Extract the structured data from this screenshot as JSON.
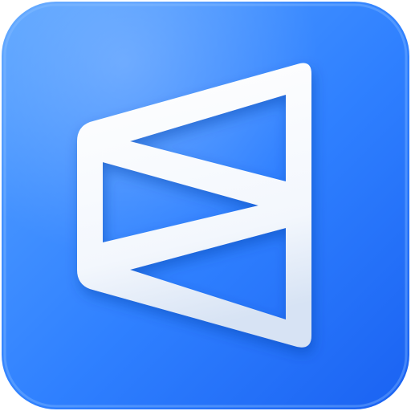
{
  "icon": {
    "name": "app-icon-glyph",
    "description_glyph": "geometric-arrow-mark-icon",
    "colors": {
      "tile_top": "#56A2FF",
      "tile_main": "#2F80FF",
      "tile_deep": "#1A62F2",
      "glyph_light": "#FFFFFF",
      "glyph_shade": "#D7E3F4",
      "inner_blue": "#2E78F4"
    }
  }
}
